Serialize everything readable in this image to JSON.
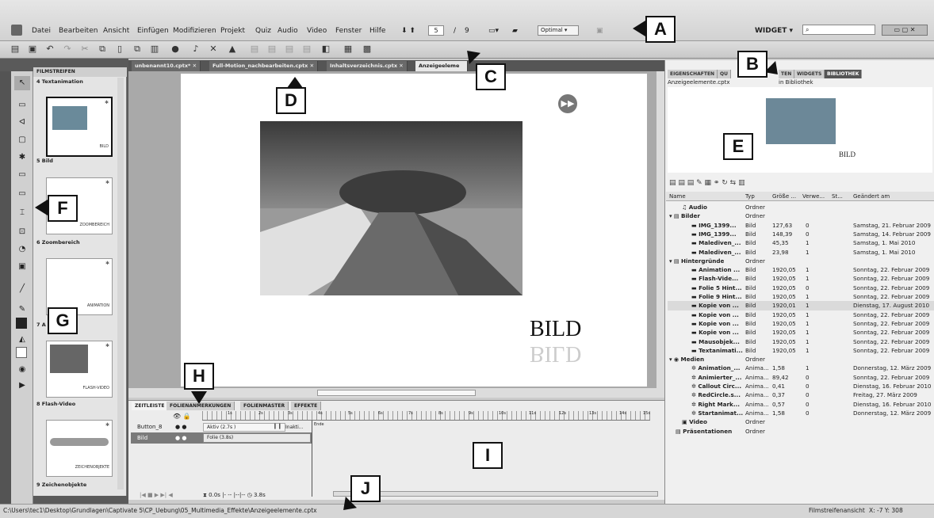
{
  "menu": [
    "Datei",
    "Bearbeiten",
    "Ansicht",
    "Einfügen",
    "Modifizieren",
    "Projekt",
    "Quiz",
    "Audio",
    "Video",
    "Fenster",
    "Hilfe"
  ],
  "slide_nav": {
    "current": "5",
    "sep": "/",
    "total": "9"
  },
  "zoom": "Optimal",
  "workspace": "WIDGET",
  "tabs": [
    "unbenannt10.cptx*",
    "Full-Motion_nachbearbeiten.cptx",
    "Inhaltsverzeichnis.cptx",
    "Anzeigeeleme"
  ],
  "filmstrip": {
    "header": "FILMSTREIFEN",
    "labels": [
      "4 Textanimation",
      "5 Bild",
      "6 Zoombereich",
      "7 A",
      "8 Flash-Video",
      "9 Zeichenobjekte"
    ],
    "thumb_texts": [
      "BILD",
      "ZOOMBEREICH",
      "ANIMATION",
      "FLASH-VIDEO",
      "ZEICHENOBJEKTE"
    ]
  },
  "slide": {
    "title": "BILD"
  },
  "timeline": {
    "tabs": [
      "ZEITLEISTE",
      "FOLIENANMERKUNGEN",
      "FOLIENMASTER",
      "EFFEKTE"
    ],
    "rows": [
      {
        "name": "Button_8",
        "bar": "Aktiv (2.7s )",
        "end": "Inakti..."
      },
      {
        "name": "Bild",
        "bar": "Folie (3.8s)"
      }
    ],
    "end_label": "Ende",
    "ticks": [
      "1s",
      "2s",
      "3s",
      "4s",
      "5s",
      "6s",
      "7s",
      "8s",
      "9s",
      "10s",
      "11s",
      "12s",
      "13s",
      "14s",
      "15s"
    ],
    "footer": [
      "0.0s",
      "|- --",
      "|--|--",
      "3.8s"
    ]
  },
  "library": {
    "tabs": [
      "EIGENSCHAFTEN",
      "QU",
      "TEN",
      "WIDGETS",
      "BIBLIOTHEK"
    ],
    "file": "Anzeigeelemente.cptx",
    "file_suffix": "in Bibliothek",
    "preview_text": "BILD",
    "columns": [
      "Name",
      "Typ",
      "Größe ...",
      "Verwe...",
      "St...",
      "Geändert am"
    ],
    "rows": [
      {
        "name": "Audio",
        "type": "Ordner",
        "size": "",
        "use": "",
        "date": ""
      },
      {
        "name": "Bilder",
        "type": "Ordner",
        "size": "",
        "use": "",
        "date": ""
      },
      {
        "name": "IMG_1399...",
        "type": "Bild",
        "size": "127,63",
        "use": "0",
        "date": "Samstag, 21. Februar 2009"
      },
      {
        "name": "IMG_1399...",
        "type": "Bild",
        "size": "148,39",
        "use": "0",
        "date": "Samstag, 14. Februar 2009"
      },
      {
        "name": "Malediven_...",
        "type": "Bild",
        "size": "45,35",
        "use": "1",
        "date": "Samstag, 1. Mai 2010"
      },
      {
        "name": "Malediven_...",
        "type": "Bild",
        "size": "23,98",
        "use": "1",
        "date": "Samstag, 1. Mai 2010"
      },
      {
        "name": "Hintergründe",
        "type": "Ordner",
        "size": "",
        "use": "",
        "date": ""
      },
      {
        "name": "Animation ...",
        "type": "Bild",
        "size": "1920,05",
        "use": "1",
        "date": "Sonntag, 22. Februar 2009"
      },
      {
        "name": "Flash-Vide...",
        "type": "Bild",
        "size": "1920,05",
        "use": "1",
        "date": "Sonntag, 22. Februar 2009"
      },
      {
        "name": "Folie 5 Hint...",
        "type": "Bild",
        "size": "1920,05",
        "use": "0",
        "date": "Sonntag, 22. Februar 2009"
      },
      {
        "name": "Folie 9 Hint...",
        "type": "Bild",
        "size": "1920,05",
        "use": "1",
        "date": "Sonntag, 22. Februar 2009"
      },
      {
        "name": "Kopie von ...",
        "type": "Bild",
        "size": "1920,01",
        "use": "1",
        "date": "Dienstag, 17. August 2010"
      },
      {
        "name": "Kopie von ...",
        "type": "Bild",
        "size": "1920,05",
        "use": "1",
        "date": "Sonntag, 22. Februar 2009"
      },
      {
        "name": "Kopie von ...",
        "type": "Bild",
        "size": "1920,05",
        "use": "1",
        "date": "Sonntag, 22. Februar 2009"
      },
      {
        "name": "Kopie von ...",
        "type": "Bild",
        "size": "1920,05",
        "use": "1",
        "date": "Sonntag, 22. Februar 2009"
      },
      {
        "name": "Mausobjek...",
        "type": "Bild",
        "size": "1920,05",
        "use": "1",
        "date": "Sonntag, 22. Februar 2009"
      },
      {
        "name": "Textanimati...",
        "type": "Bild",
        "size": "1920,05",
        "use": "1",
        "date": "Sonntag, 22. Februar 2009"
      },
      {
        "name": "Medien",
        "type": "Ordner",
        "size": "",
        "use": "",
        "date": ""
      },
      {
        "name": "Animation_...",
        "type": "Anima...",
        "size": "1,58",
        "use": "1",
        "date": "Donnerstag, 12. März 2009"
      },
      {
        "name": "Animierter_...",
        "type": "Anima...",
        "size": "89,42",
        "use": "0",
        "date": "Sonntag, 22. Februar 2009"
      },
      {
        "name": "Callout Circ...",
        "type": "Anima...",
        "size": "0,41",
        "use": "0",
        "date": "Dienstag, 16. Februar 2010"
      },
      {
        "name": "RedCircle.s...",
        "type": "Anima...",
        "size": "0,37",
        "use": "0",
        "date": "Freitag, 27. März 2009"
      },
      {
        "name": "Right Mark...",
        "type": "Anima...",
        "size": "0,57",
        "use": "0",
        "date": "Dienstag, 16. Februar 2010"
      },
      {
        "name": "Startanimat...",
        "type": "Anima...",
        "size": "1,58",
        "use": "0",
        "date": "Donnerstag, 12. März 2009"
      },
      {
        "name": "Video",
        "type": "Ordner",
        "size": "",
        "use": "",
        "date": ""
      },
      {
        "name": "Präsentationen",
        "type": "Ordner",
        "size": "",
        "use": "",
        "date": ""
      }
    ]
  },
  "status": {
    "path": "C:\\Users\\tec1\\Desktop\\Grundlagen\\Captivate 5\\CP_Uebung\\05_Multimedia_Effekte\\Anzeigeelemente.cptx",
    "view": "Filmstreifenansicht",
    "coords": "X: -7 Y: 308"
  },
  "callouts": [
    "A",
    "B",
    "C",
    "D",
    "E",
    "F",
    "G",
    "H",
    "I",
    "J"
  ]
}
